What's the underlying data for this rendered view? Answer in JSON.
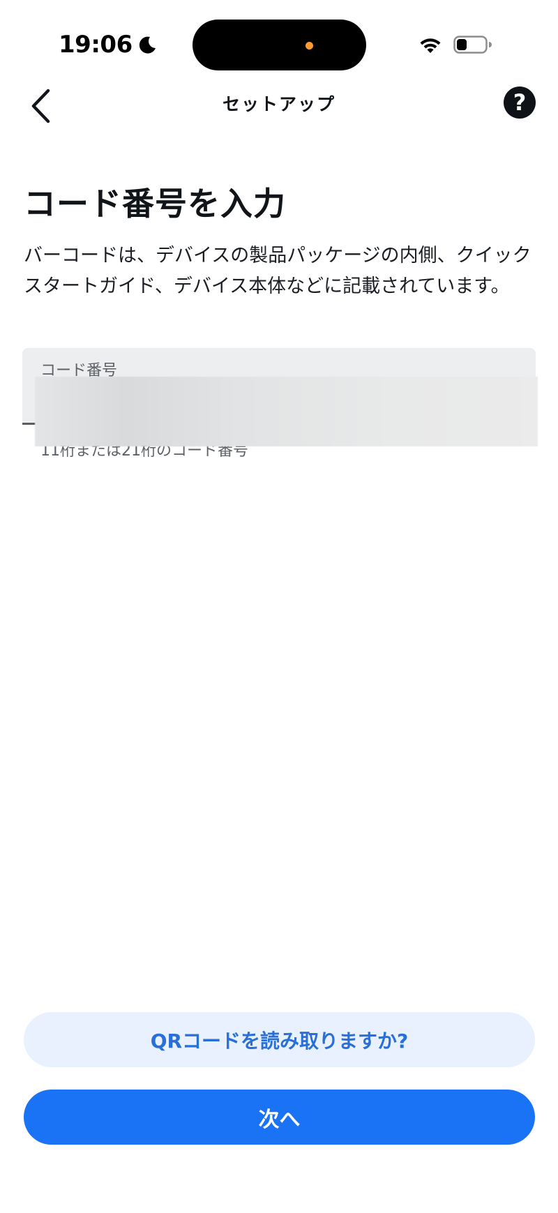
{
  "status_bar": {
    "time": "19:06",
    "icons": [
      "moon-icon",
      "wifi-icon",
      "battery-icon"
    ],
    "privacy_indicator_color": "#ff9a2e"
  },
  "nav": {
    "back_icon": "chevron-left-icon",
    "title": "セットアップ",
    "help_icon": "question-mark-icon",
    "help_label": "?"
  },
  "content": {
    "heading": "コード番号を入力",
    "description": "バーコードは、デバイスの製品パッケージの内側、クイックスタートガイド、デバイス本体などに記載されています。"
  },
  "code_field": {
    "label": "コード番号",
    "value": "",
    "placeholder": "",
    "helper_text": "11桁または21桁のコード番号"
  },
  "actions": {
    "qr_label": "QRコードを読み取りますか?",
    "next_label": "次へ"
  },
  "colors": {
    "primary": "#1a72f5",
    "primary_light": "#e8f1fd",
    "primary_text": "#2a6fd6",
    "text": "#111418",
    "field_background": "#eceeef"
  }
}
